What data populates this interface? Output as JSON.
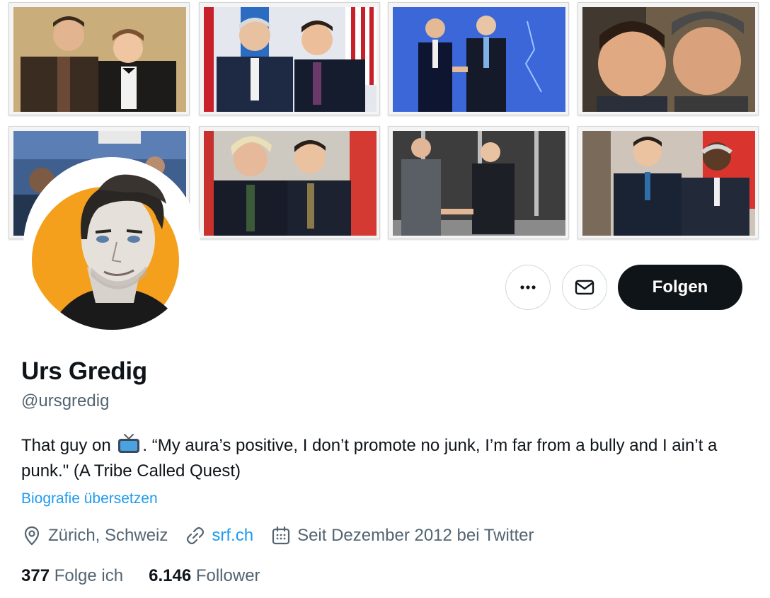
{
  "banner": {
    "photos": [
      {
        "scene": "two-men-bowtie",
        "bg": "#b89a6a"
      },
      {
        "scene": "two-men-suits-flags",
        "bg": "#dfe3ea"
      },
      {
        "scene": "handshake-blue-stage",
        "bg": "#2b57c9"
      },
      {
        "scene": "selfie-two-men",
        "bg": "#7a6a55"
      },
      {
        "scene": "crowd-blue",
        "bg": "#3f5f8f"
      },
      {
        "scene": "two-men-red-backdrop",
        "bg": "#c9c4bd"
      },
      {
        "scene": "handshake-dark-stage",
        "bg": "#4a4a4a"
      },
      {
        "scene": "two-men-seated",
        "bg": "#cbbfb4"
      }
    ]
  },
  "avatar": {
    "style": "cartoon-portrait",
    "accent": "#f4a01c"
  },
  "actions": {
    "more_icon": "more-icon",
    "mail_icon": "envelope-icon",
    "follow_label": "Folgen"
  },
  "profile": {
    "name": "Urs Gredig",
    "handle": "@ursgredig",
    "bio_before_emoji": "That guy on",
    "bio_emoji": "tv-emoji",
    "bio_after_emoji": ". “My aura’s positive, I don’t promote no junk, I’m far from a bully and I ain’t a punk.\" (A Tribe Called Quest)",
    "translate_label": "Biografie übersetzen"
  },
  "meta": {
    "location": "Zürich, Schweiz",
    "website": "srf.ch",
    "joined": "Seit Dezember 2012 bei Twitter"
  },
  "stats": {
    "following_count": "377",
    "following_label": "Folge ich",
    "followers_count": "6.146",
    "followers_label": "Follower"
  },
  "colors": {
    "text": "#0f1419",
    "secondary": "#536471",
    "link": "#1d9bf0",
    "follow_button": "#0f1419",
    "border": "#cfd9de"
  }
}
